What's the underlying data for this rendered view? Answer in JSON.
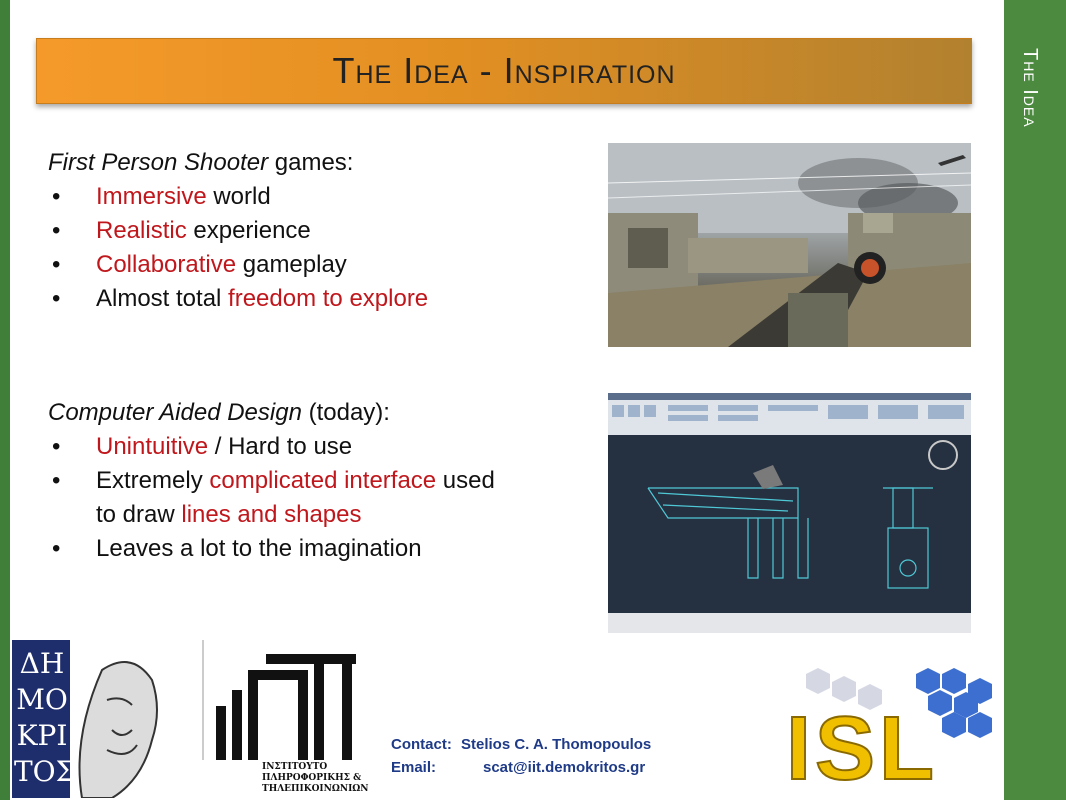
{
  "title": "The Idea - Inspiration",
  "section_label": "The Idea",
  "fps_block": {
    "heading_em": "First Person Shooter",
    "heading_rest": " games:",
    "bullets": [
      {
        "highlight": "Immersive",
        "rest": " world"
      },
      {
        "highlight": "Realistic",
        "rest": " experience"
      },
      {
        "highlight": "Collaborative",
        "rest": " gameplay"
      },
      {
        "prefix": "Almost total ",
        "highlight": "freedom to explore"
      }
    ]
  },
  "cad_block": {
    "heading_em": "Computer Aided Design",
    "heading_rest": " (today):",
    "bullets": [
      {
        "highlight": "Unintuitive",
        "rest": " / Hard to use"
      },
      {
        "prefix": "Extremely ",
        "highlight": "complicated interface",
        "rest": " used"
      },
      {
        "prefix": "to draw ",
        "highlight": "lines and shapes"
      },
      {
        "plain": "Leaves a lot to the imagination"
      }
    ]
  },
  "bullet_glyph": "•",
  "contact": {
    "contact_label": "Contact:",
    "contact_name": "Stelios C. A. Thomopoulos",
    "email_label": "Email:",
    "email_value": "scat@iit.demokritos.gr"
  },
  "logos": {
    "demokritos_letters": [
      "ΔΗ",
      "ΜΟ",
      "ΚΡΙ",
      "ΤΟΣ"
    ],
    "iit_text": [
      "ΙΝΣΤΙΤΟΥΤΟ",
      "ΠΛΗΡΟΦΟΡΙΚΗΣ &",
      "ΤΗΛΕΠΙΚΟΙΝΩΝΙΩΝ"
    ],
    "isl_text": "ISL"
  },
  "colors": {
    "accent_red": "#c0171c",
    "band_green": "#4c8a3f",
    "banner_orange": "#f59a2a",
    "contact_blue": "#1f3b88"
  }
}
